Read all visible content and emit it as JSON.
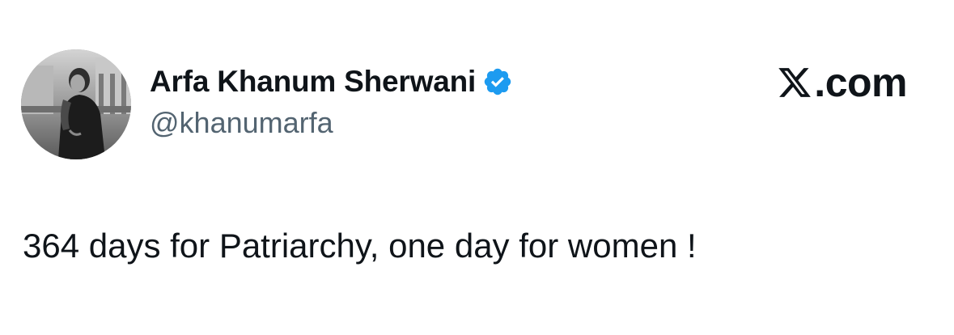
{
  "author": {
    "display_name": "Arfa Khanum Sherwani",
    "handle": "@khanumarfa",
    "verified": true,
    "avatar_icon": "profile-photo",
    "badge_icon": "verified-badge-icon"
  },
  "brand": {
    "logo_icon": "x-logo-icon",
    "suffix": ".com"
  },
  "tweet": {
    "text": "364 days for Patriarchy, one day for women !"
  },
  "colors": {
    "text_primary": "#0f1419",
    "text_secondary": "#536471",
    "verified_blue": "#1d9bf0",
    "background": "#ffffff"
  }
}
